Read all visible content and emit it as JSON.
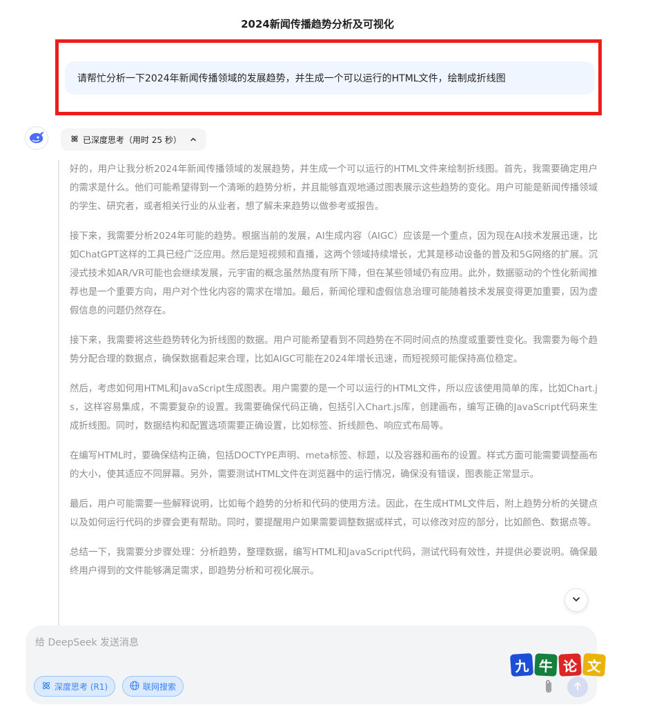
{
  "page": {
    "title": "2024新闻传播趋势分析及可视化"
  },
  "user_message": {
    "text": "请帮忙分析一下2024年新闻传播领域的发展趋势，并生成一个可以运行的HTML文件，绘制成折线图"
  },
  "assistant": {
    "avatar_icon": "deepseek-whale-icon",
    "thinking_label": "已深度思考（用时 25 秒）",
    "thinking_paragraphs": [
      "好的，用户让我分析2024年新闻传播领域的发展趋势，并生成一个可以运行的HTML文件来绘制折线图。首先，我需要确定用户的需求是什么。他们可能希望得到一个清晰的趋势分析，并且能够直观地通过图表展示这些趋势的变化。用户可能是新闻传播领域的学生、研究者，或者相关行业的从业者，想了解未来趋势以做参考或报告。",
      "接下来，我需要分析2024年可能的趋势。根据当前的发展，AI生成内容（AIGC）应该是一个重点，因为现在AI技术发展迅速，比如ChatGPT这样的工具已经广泛应用。然后是短视频和直播，这两个领域持续增长，尤其是移动设备的普及和5G网络的扩展。沉浸式技术如AR/VR可能也会继续发展，元宇宙的概念虽然热度有所下降，但在某些领域仍有应用。此外，数据驱动的个性化新闻推荐也是一个重要方向，用户对个性化内容的需求在增加。最后，新闻伦理和虚假信息治理可能随着技术发展变得更加重要，因为虚假信息的问题仍然存在。",
      "接下来，我需要将这些趋势转化为折线图的数据。用户可能希望看到不同趋势在不同时间点的热度或重要性变化。我需要为每个趋势分配合理的数据点，确保数据看起来合理，比如AIGC可能在2024年增长迅速，而短视频可能保持高位稳定。",
      "然后，考虑如何用HTML和JavaScript生成图表。用户需要的是一个可以运行的HTML文件，所以应该使用简单的库，比如Chart.js，这样容易集成，不需要复杂的设置。我需要确保代码正确，包括引入Chart.js库，创建画布，编写正确的JavaScript代码来生成折线图。同时，数据结构和配置选项需要正确设置，比如标签、折线颜色、响应式布局等。",
      "在编写HTML时，要确保结构正确，包括DOCTYPE声明、meta标签、标题，以及容器和画布的设置。样式方面可能需要调整画布的大小，使其适应不同屏幕。另外，需要测试HTML文件在浏览器中的运行情况，确保没有错误，图表能正常显示。",
      "最后，用户可能需要一些解释说明，比如每个趋势的分析和代码的使用方法。因此，在生成HTML文件后，附上趋势分析的关键点以及如何运行代码的步骤会更有帮助。同时，要提醒用户如果需要调整数据或样式，可以修改对应的部分，比如颜色、数据点等。",
      "总结一下，我需要分步骤处理：分析趋势，整理数据，编写HTML和JavaScript代码，测试代码有效性，并提供必要说明。确保最终用户得到的文件能够满足需求，即趋势分析和可视化展示。"
    ]
  },
  "composer": {
    "placeholder": "给 DeepSeek 发送消息",
    "deep_think_label": "深度思考 (R1)",
    "web_search_label": "联网搜索"
  },
  "watermark": {
    "chars": [
      "九",
      "牛",
      "论",
      "文"
    ]
  },
  "colors": {
    "highlight_border": "#ef1c1c",
    "accent_blue": "#3b82f6",
    "user_bubble": "#eff6ff",
    "composer_bg": "#f3f4f6"
  }
}
